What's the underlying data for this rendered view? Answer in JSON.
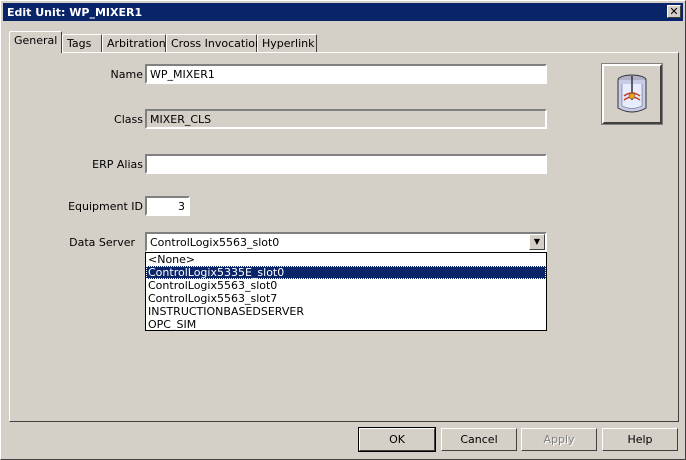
{
  "window": {
    "title": "Edit Unit:  WP_MIXER1"
  },
  "tabs": [
    {
      "label": "General",
      "active": true
    },
    {
      "label": "Tags"
    },
    {
      "label": "Arbitration"
    },
    {
      "label": "Cross Invocation"
    },
    {
      "label": "Hyperlink"
    }
  ],
  "form": {
    "name_label": "Name",
    "name_value": "WP_MIXER1",
    "class_label": "Class",
    "class_value": "MIXER_CLS",
    "erp_label": "ERP Alias",
    "erp_value": "",
    "equip_label": "Equipment ID",
    "equip_value": "3",
    "server_label": "Data Server",
    "server_value": "ControlLogix5563_slot0"
  },
  "server_options": [
    "<None>",
    "ControlLogix5335E_slot0",
    "ControlLogix5563_slot0",
    "ControlLogix5563_slot7",
    "INSTRUCTIONBASEDSERVER",
    "OPC_SIM"
  ],
  "selected_option_index": 1,
  "icon": "mixer-tank-icon",
  "buttons": {
    "ok": "OK",
    "cancel": "Cancel",
    "apply": "Apply",
    "help": "Help"
  },
  "colors": {
    "titlebar": "#0a246a",
    "face": "#d4d0c8",
    "highlight": "#0a246a"
  }
}
